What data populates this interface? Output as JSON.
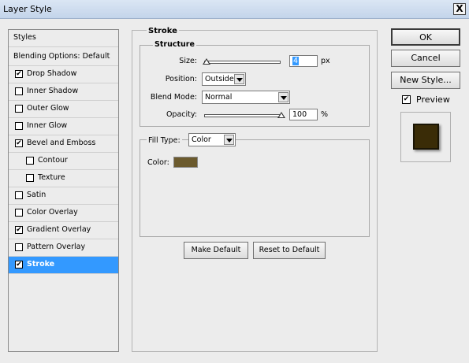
{
  "window": {
    "title": "Layer Style",
    "close_glyph": "X"
  },
  "styles_list": {
    "header": "Styles",
    "blending_options": "Blending Options: Default",
    "items": [
      {
        "label": "Drop Shadow",
        "checked": true
      },
      {
        "label": "Inner Shadow",
        "checked": false
      },
      {
        "label": "Outer Glow",
        "checked": false
      },
      {
        "label": "Inner Glow",
        "checked": false
      },
      {
        "label": "Bevel and Emboss",
        "checked": true
      },
      {
        "label": "Contour",
        "checked": false
      },
      {
        "label": "Texture",
        "checked": false
      },
      {
        "label": "Satin",
        "checked": false
      },
      {
        "label": "Color Overlay",
        "checked": false
      },
      {
        "label": "Gradient Overlay",
        "checked": true
      },
      {
        "label": "Pattern Overlay",
        "checked": false
      },
      {
        "label": "Stroke",
        "checked": true
      }
    ],
    "selected": "Stroke"
  },
  "stroke": {
    "panel_title": "Stroke",
    "structure_title": "Structure",
    "size": {
      "label": "Size:",
      "value": "4",
      "unit": "px"
    },
    "position": {
      "label": "Position:",
      "value": "Outside"
    },
    "blend_mode": {
      "label": "Blend Mode:",
      "value": "Normal"
    },
    "opacity": {
      "label": "Opacity:",
      "value": "100",
      "unit": "%"
    },
    "fill_type": {
      "label": "Fill Type:",
      "value": "Color"
    },
    "color": {
      "label": "Color:",
      "swatch": "#6b5a2d"
    },
    "make_default": "Make Default",
    "reset_default": "Reset to Default"
  },
  "buttons": {
    "ok": "OK",
    "cancel": "Cancel",
    "new_style": "New Style..."
  },
  "preview": {
    "label": "Preview",
    "checked": true,
    "swatch_color": "#3a2c07"
  },
  "colors": {
    "selection": "#3399ff",
    "check_mark": "✔"
  }
}
